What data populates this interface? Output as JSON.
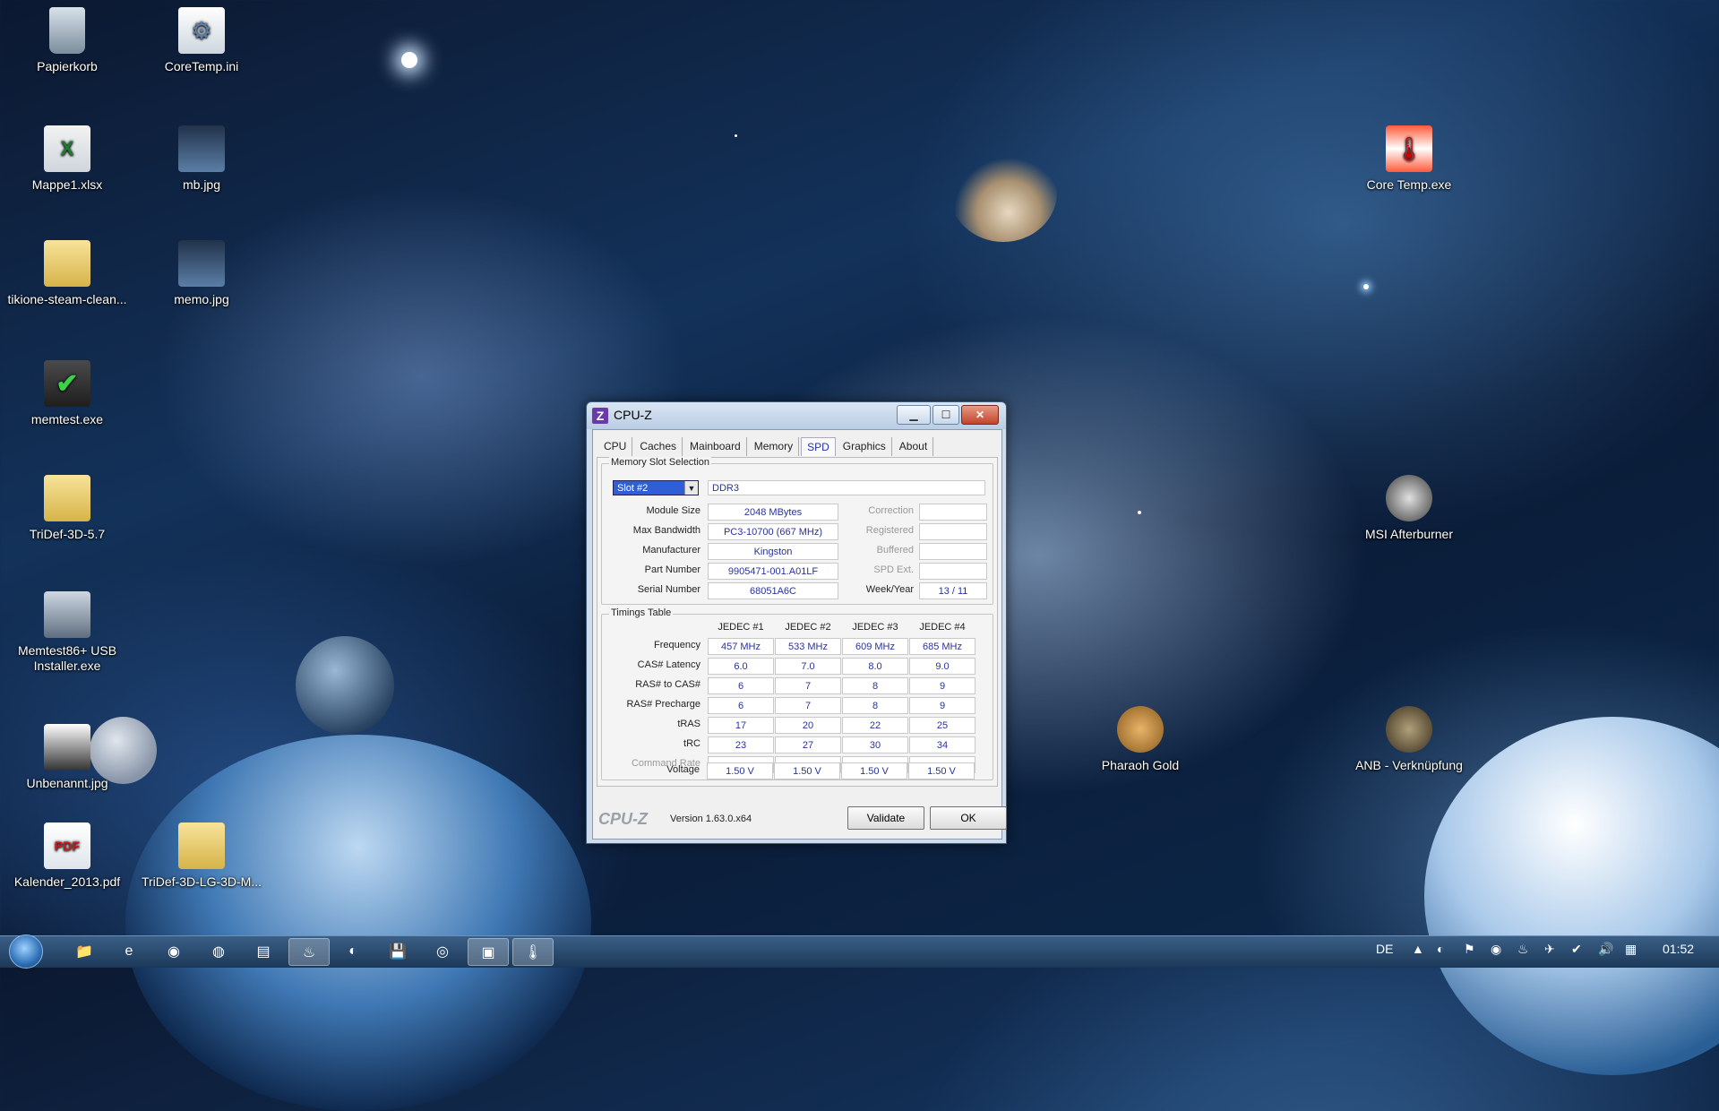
{
  "desktop": {
    "icons": [
      {
        "label": "Papierkorb"
      },
      {
        "label": "CoreTemp.ini"
      },
      {
        "label": "Mappe1.xlsx"
      },
      {
        "label": "mb.jpg"
      },
      {
        "label": "tikione-steam-clean..."
      },
      {
        "label": "memo.jpg"
      },
      {
        "label": "memtest.exe"
      },
      {
        "label": "TriDef-3D-5.7"
      },
      {
        "label": "Memtest86+ USB Installer.exe"
      },
      {
        "label": "Unbenannt.jpg"
      },
      {
        "label": "Kalender_2013.pdf"
      },
      {
        "label": "TriDef-3D-LG-3D-M..."
      },
      {
        "label": "Core Temp.exe"
      },
      {
        "label": "MSI Afterburner"
      },
      {
        "label": "Pharaoh Gold"
      },
      {
        "label": "ANB - Verknüpfung"
      }
    ]
  },
  "window": {
    "title": "CPU-Z",
    "logo": "Z",
    "tabs": [
      "CPU",
      "Caches",
      "Mainboard",
      "Memory",
      "SPD",
      "Graphics",
      "About"
    ],
    "selected_tab": "SPD",
    "slot_group": {
      "title": "Memory Slot Selection",
      "slot_value": "Slot #2",
      "memory_type": "DDR3",
      "rows": [
        {
          "label": "Module Size",
          "value": "2048 MBytes",
          "right_label": "Correction",
          "right_value": ""
        },
        {
          "label": "Max Bandwidth",
          "value": "PC3-10700 (667 MHz)",
          "right_label": "Registered",
          "right_value": ""
        },
        {
          "label": "Manufacturer",
          "value": "Kingston",
          "right_label": "Buffered",
          "right_value": ""
        },
        {
          "label": "Part Number",
          "value": "9905471-001.A01LF",
          "right_label": "SPD Ext.",
          "right_value": ""
        },
        {
          "label": "Serial Number",
          "value": "68051A6C",
          "right_label": "Week/Year",
          "right_value": "13 / 11"
        }
      ]
    },
    "timings": {
      "title": "Timings Table",
      "columns": [
        "JEDEC #1",
        "JEDEC #2",
        "JEDEC #3",
        "JEDEC #4"
      ],
      "rows": [
        {
          "label": "Frequency",
          "values": [
            "457 MHz",
            "533 MHz",
            "609 MHz",
            "685 MHz"
          ]
        },
        {
          "label": "CAS# Latency",
          "values": [
            "6.0",
            "7.0",
            "8.0",
            "9.0"
          ]
        },
        {
          "label": "RAS# to CAS#",
          "values": [
            "6",
            "7",
            "8",
            "9"
          ]
        },
        {
          "label": "RAS# Precharge",
          "values": [
            "6",
            "7",
            "8",
            "9"
          ]
        },
        {
          "label": "tRAS",
          "values": [
            "17",
            "20",
            "22",
            "25"
          ]
        },
        {
          "label": "tRC",
          "values": [
            "23",
            "27",
            "30",
            "34"
          ]
        },
        {
          "label": "Command Rate",
          "values": [
            "",
            "",
            "",
            ""
          ]
        },
        {
          "label": "Voltage",
          "values": [
            "1.50 V",
            "1.50 V",
            "1.50 V",
            "1.50 V"
          ]
        }
      ]
    },
    "footer": {
      "brand": "CPU-Z",
      "version": "Version 1.63.0.x64",
      "validate_label": "Validate",
      "ok_label": "OK"
    }
  },
  "taskbar": {
    "language": "DE",
    "clock": "01:52"
  }
}
